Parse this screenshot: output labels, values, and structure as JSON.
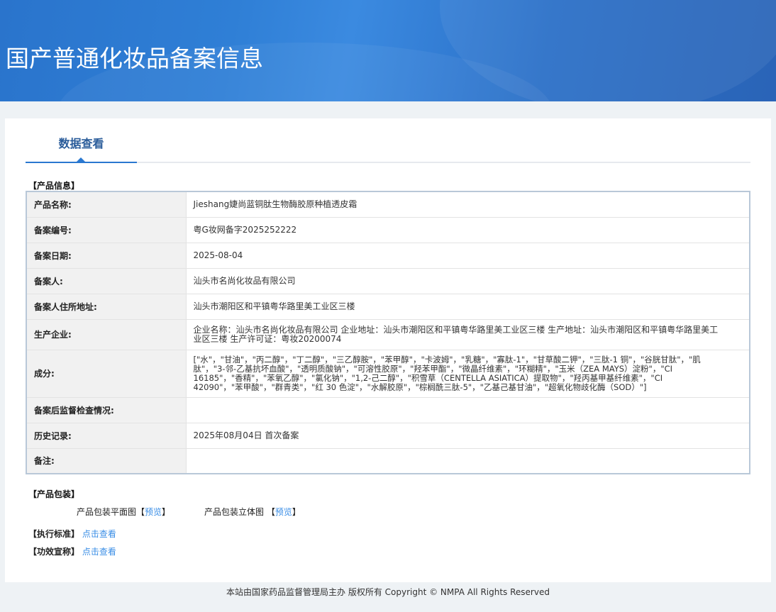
{
  "header": {
    "title": "国产普通化妆品备案信息"
  },
  "tabs": [
    {
      "label": "数据查看",
      "active": true
    }
  ],
  "product_info": {
    "section_title": "【产品信息】",
    "rows": [
      {
        "label": "产品名称:",
        "value": "Jieshang婕尚蓝铜肽生物酶胶原种植透皮霜"
      },
      {
        "label": "备案编号:",
        "value": "粤G妆网备字2025252222"
      },
      {
        "label": "备案日期:",
        "value": "2025-08-04"
      },
      {
        "label": "备案人:",
        "value": "汕头市名尚化妆品有限公司"
      },
      {
        "label": "备案人住所地址:",
        "value": "汕头市潮阳区和平镇粤华路里美工业区三楼"
      },
      {
        "label": "生产企业:",
        "value": "企业名称：汕头市名尚化妆品有限公司 企业地址：汕头市潮阳区和平镇粤华路里美工业区三楼 生产地址：汕头市潮阳区和平镇粤华路里美工业区三楼 生产许可证：粤妆20200074"
      },
      {
        "label": "成分:",
        "value": "[\"水\"，\"甘油\"，\"丙二醇\"，\"丁二醇\"，\"三乙醇胺\"，\"苯甲醇\"，\"卡波姆\"，\"乳糖\"，\"寡肽-1\"，\"甘草酸二钾\"，\"三肽-1 铜\"，\"谷胱甘肽\"，\"肌肽\"，\"3-邻-乙基抗坏血酸\"，\"透明质酸钠\"，\"可溶性胶原\"，\"羟苯甲酯\"，\"微晶纤维素\"，\"环糊精\"，\"玉米（ZEA MAYS）淀粉\"，\"CI 16185\"，\"香精\"，\"苯氧乙醇\"，\"氯化钠\"，\"1,2-己二醇\"，\"积雪草（CENTELLA ASIATICA）提取物\"，\"羟丙基甲基纤维素\"，\"CI 42090\"，\"苯甲酸\"，\"群青类\"，\"红 30 色淀\"，\"水解胶原\"，\"棕榈酰三肽-5\"，\"乙基己基甘油\"，\"超氧化物歧化酶（SOD）\"]"
      },
      {
        "label": "备案后监督检查情况:",
        "value": ""
      },
      {
        "label": "历史记录:",
        "value": "2025年08月04日 首次备案"
      },
      {
        "label": "备注:",
        "value": ""
      }
    ]
  },
  "packaging": {
    "section_title": "【产品包装】",
    "flat_label": "产品包装平面图",
    "stereo_label": "产品包装立体图",
    "preview_link": "预览",
    "bracket_open": "【",
    "bracket_close": "】"
  },
  "standard": {
    "label": "【执行标准】",
    "link": "点击查看"
  },
  "efficacy": {
    "label": "【功效宣称】",
    "link": "点击查看"
  },
  "footer": {
    "text": "本站由国家药品监督管理局主办 版权所有 Copyright © NMPA All Rights Reserved"
  }
}
